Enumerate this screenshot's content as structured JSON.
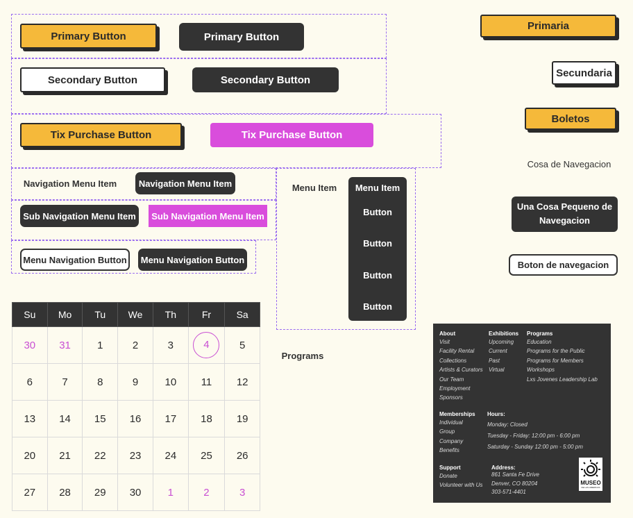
{
  "primary": {
    "yellow": "Primary Button",
    "dark": "Primary Button"
  },
  "secondary": {
    "white": "Secondary Button",
    "dark": "Secondary Button"
  },
  "tix": {
    "yellow": "Tix Purchase Button",
    "pink": "Tix Purchase Button"
  },
  "nav_item": {
    "plain": "Navigation Menu Item",
    "dark": "Navigation Menu Item"
  },
  "sub_nav": {
    "dark": "Sub Navigation Menu Item",
    "pink": "Sub Navigation Menu Item"
  },
  "menu_nav": {
    "outline": "Menu Navigation Button",
    "dark": "Menu Navigation Button"
  },
  "menu": {
    "label": "Menu Item",
    "header": "Menu Item",
    "items": [
      "Button",
      "Button",
      "Button",
      "Button"
    ]
  },
  "programs_label": "Programs",
  "spanish": {
    "primaria": "Primaria",
    "secundaria": "Secundaria",
    "boletos": "Boletos",
    "nav_text": "Cosa de Navegacion",
    "small_nav_line1": "Una Cosa Pequeno de",
    "small_nav_line2": "Navegacion",
    "nav_button": "Boton de navegacion"
  },
  "calendar": {
    "days": [
      "Su",
      "Mo",
      "Tu",
      "We",
      "Th",
      "Fr",
      "Sa"
    ],
    "weeks": [
      [
        "30",
        "31",
        "1",
        "2",
        "3",
        "4",
        "5"
      ],
      [
        "6",
        "7",
        "8",
        "9",
        "10",
        "11",
        "12"
      ],
      [
        "13",
        "14",
        "15",
        "16",
        "17",
        "18",
        "19"
      ],
      [
        "20",
        "21",
        "22",
        "23",
        "24",
        "25",
        "26"
      ],
      [
        "27",
        "28",
        "29",
        "30",
        "1",
        "2",
        "3"
      ]
    ],
    "selected": "4"
  },
  "footer": {
    "about": {
      "title": "About",
      "links": [
        "Visit",
        "Facility Rental",
        "Collections",
        "Artists & Curators",
        "Our Team",
        "Employment",
        "Sponsors"
      ]
    },
    "exhibitions": {
      "title": "Exhibitions",
      "links": [
        "Upcoming",
        "Current",
        "Past",
        "Virtual"
      ]
    },
    "programs": {
      "title": "Programs",
      "links": [
        "Education",
        "Programs for the Public",
        "Programs for Members",
        "Workshops",
        "Lxs Jovenes Leadership Lab"
      ]
    },
    "memberships": {
      "title": "Memberships",
      "links": [
        "Individual",
        "Group",
        "Company",
        "Benefits"
      ]
    },
    "hours": {
      "title": "Hours:",
      "lines": [
        "Monday: Closed",
        "Tuesday - Friday: 12:00 pm - 6:00 pm",
        "Saturday - Sunday 12:00 pm - 5:00 pm"
      ]
    },
    "support": {
      "title": "Support",
      "links": [
        "Donate",
        "Volunteer with Us"
      ]
    },
    "address": {
      "title": "Address:",
      "lines": [
        "861 Santa Fe Drive",
        "Denver, CO 80204",
        "303-571-4401"
      ]
    },
    "logo": {
      "name": "MUSEO",
      "sub": "DE LAS AMERICAS"
    }
  }
}
